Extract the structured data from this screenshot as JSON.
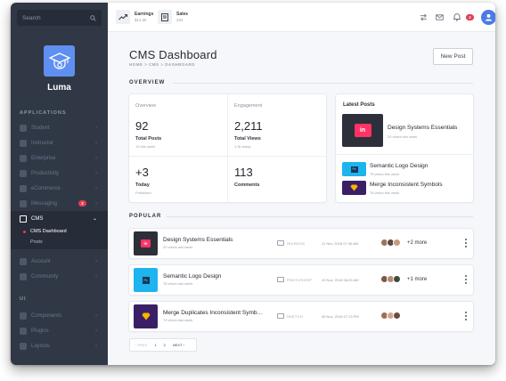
{
  "app": {
    "name": "Luma"
  },
  "sidebar": {
    "search_placeholder": "Search",
    "applications_heading": "APPLICATIONS",
    "ui_heading": "UI",
    "items": [
      {
        "label": "Student"
      },
      {
        "label": "Instructor"
      },
      {
        "label": "Enterprise"
      },
      {
        "label": "Productivity"
      },
      {
        "label": "eCommerce"
      },
      {
        "label": "Messaging",
        "badge": "2"
      },
      {
        "label": "CMS"
      },
      {
        "label": "Account"
      },
      {
        "label": "Community"
      }
    ],
    "cms_sub": [
      {
        "label": "CMS Dashboard"
      },
      {
        "label": "Posts"
      }
    ],
    "ui_items": [
      {
        "label": "Components"
      },
      {
        "label": "Plugins"
      },
      {
        "label": "Layouts"
      }
    ]
  },
  "topbar": {
    "earnings_label": "Earnings",
    "earnings_value": "$12.3k",
    "sales_label": "Sales",
    "sales_value": "264",
    "notification_count": "2"
  },
  "header": {
    "title": "CMS Dashboard",
    "breadcrumb": "HOME > CMS > DASHBOARD",
    "new_post_label": "New Post"
  },
  "overview": {
    "section_label": "OVERVIEW",
    "overview_head": "Overview",
    "engagement_head": "Engagement",
    "kpis": [
      {
        "value": "92",
        "label": "Total Posts",
        "sub": "13 this week"
      },
      {
        "value": "2,211",
        "label": "Total Views",
        "sub": "1.3k today"
      },
      {
        "value": "+3",
        "label": "Today",
        "sub": "Published"
      },
      {
        "value": "113",
        "label": "Comments",
        "sub": ""
      }
    ]
  },
  "latest": {
    "title": "Latest Posts",
    "items": [
      {
        "title": "Design Systems Essentials",
        "sub": "20 views this week"
      },
      {
        "title": "Semantic Logo Design",
        "sub": "78 views this week"
      },
      {
        "title": "Merge Inconsistent Symbols",
        "sub": "78 views this week"
      }
    ]
  },
  "popular": {
    "section_label": "POPULAR",
    "rows": [
      {
        "title": "Design Systems Essentials",
        "sub": "20 views last week",
        "tag": "INVISION",
        "date": "11 Nov, 2018 07:46 AM",
        "more": "+2 more"
      },
      {
        "title": "Semantic Logo Design",
        "sub": "78 views last week",
        "tag": "PHOTOSHOP",
        "date": "10 Nov, 2018 08:25 AM",
        "more": "+1 more"
      },
      {
        "title": "Merge Duplicates Inconsistent Symb…",
        "sub": "78 views last week",
        "tag": "SKETCH",
        "date": "06 Nov, 2018 07:13 PM",
        "more": ""
      }
    ]
  },
  "pagination": {
    "prev": "‹ PREV",
    "pages": [
      "1",
      "2"
    ],
    "next": "NEXT ›"
  },
  "colors": {
    "sidebar": "#303846",
    "accent_blue": "#5f8ff0",
    "badge_red": "#e53c54",
    "invision": "#ff3366",
    "photoshop": "#1eb4ee",
    "sketch": "#3b1f66"
  }
}
